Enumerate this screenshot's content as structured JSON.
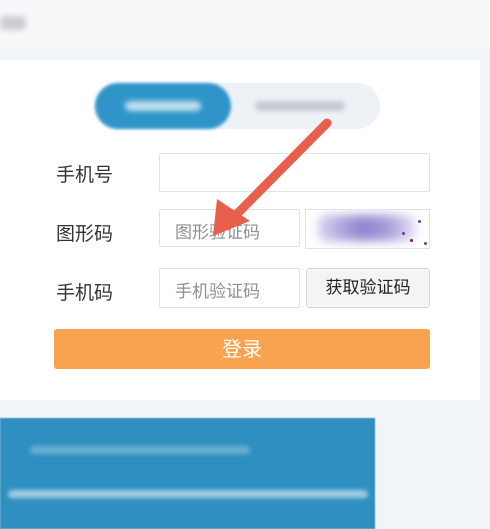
{
  "form": {
    "phone_label": "手机号",
    "captcha_label": "图形码",
    "captcha_placeholder": "图形验证码",
    "sms_label": "手机码",
    "sms_placeholder": "手机验证码",
    "get_code_button": "获取验证码",
    "login_button": "登录"
  },
  "colors": {
    "tab_active": "#2f95c8",
    "login_button": "#f9a24f",
    "arrow": "#e8604c"
  },
  "icons": {
    "annotation_arrow": "arrow-icon"
  }
}
